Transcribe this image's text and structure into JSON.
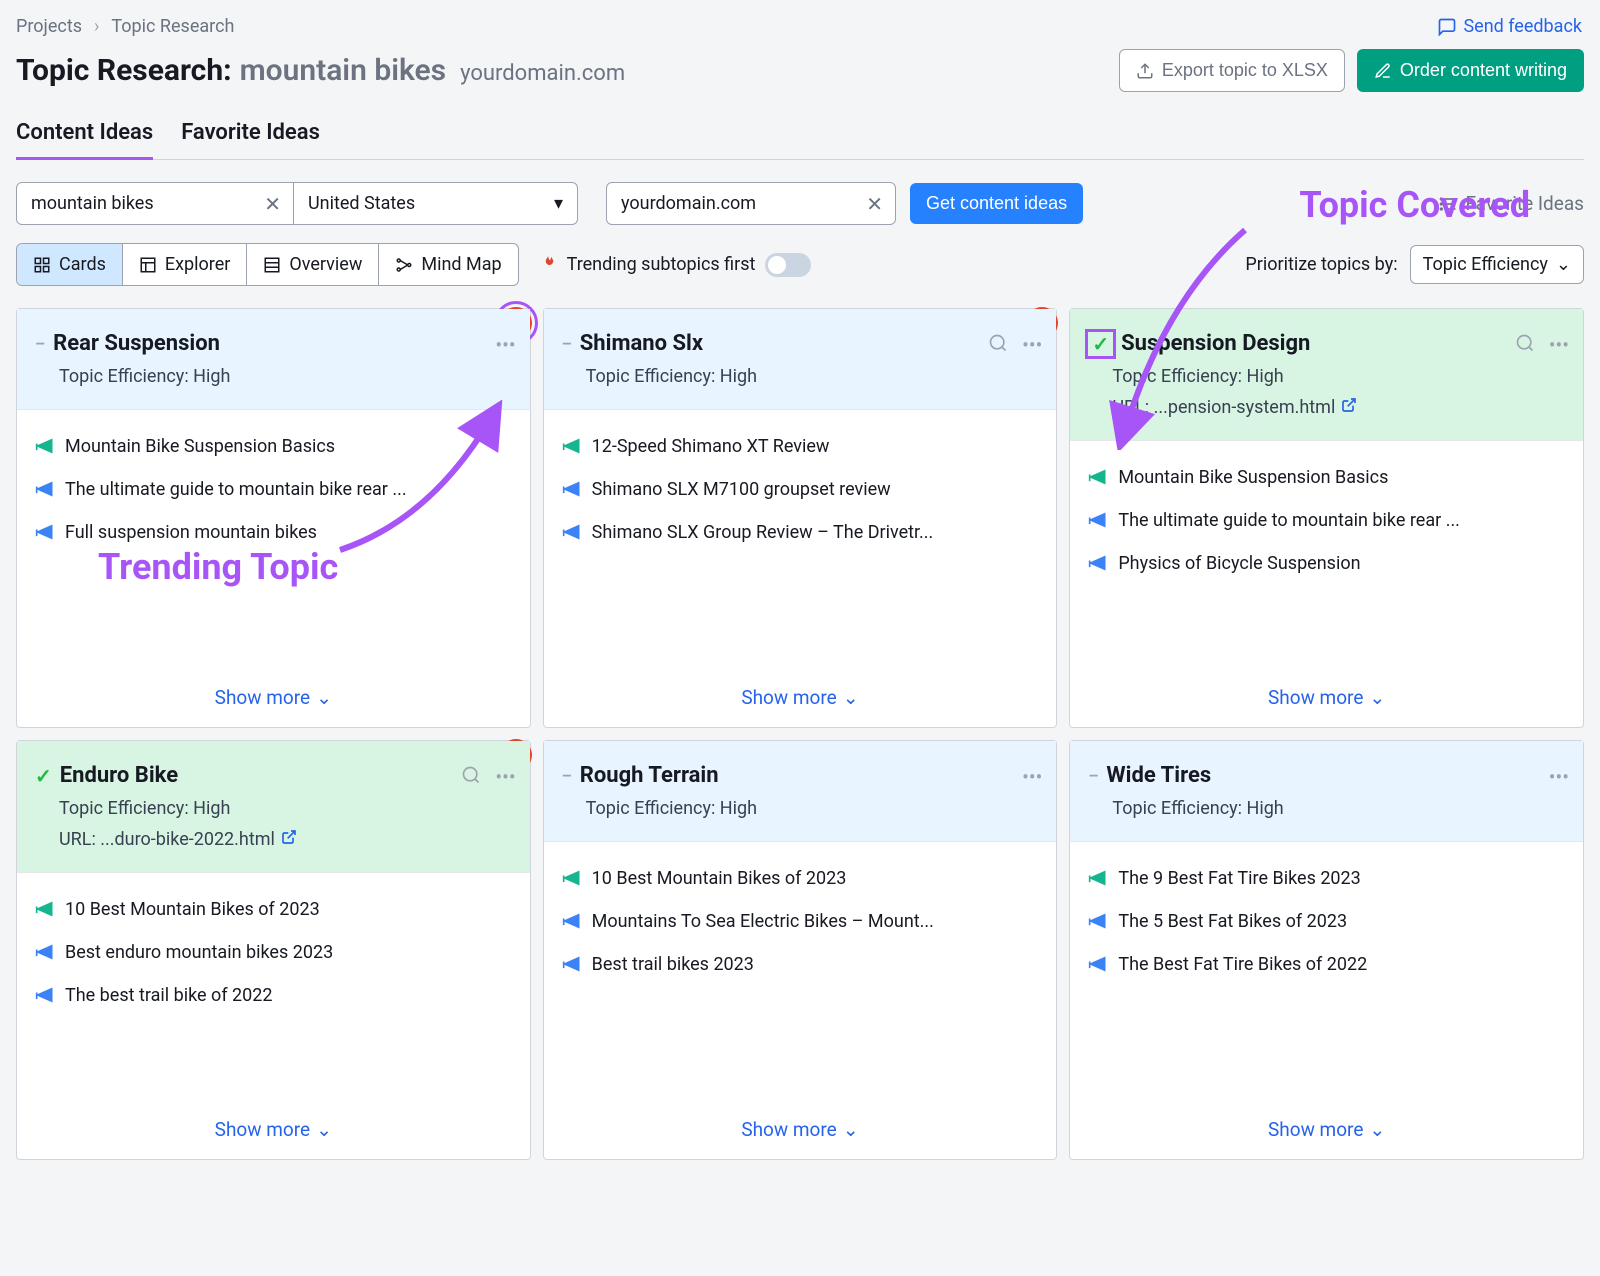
{
  "breadcrumb": {
    "root": "Projects",
    "current": "Topic Research"
  },
  "feedback_label": "Send feedback",
  "page_title": {
    "prefix": "Topic Research:",
    "query": "mountain bikes",
    "domain": "yourdomain.com"
  },
  "actions": {
    "export": "Export topic to XLSX",
    "order": "Order content writing"
  },
  "tabs": {
    "content": "Content Ideas",
    "favorite": "Favorite Ideas"
  },
  "filters": {
    "topic_value": "mountain bikes",
    "country_value": "United States",
    "domain_value": "yourdomain.com",
    "submit": "Get content ideas",
    "favorite_link": "Favorite Ideas"
  },
  "views": {
    "cards": "Cards",
    "explorer": "Explorer",
    "overview": "Overview",
    "mindmap": "Mind Map"
  },
  "trending_toggle_label": "Trending subtopics first",
  "prioritize": {
    "label": "Prioritize topics by:",
    "value": "Topic Efficiency"
  },
  "annotations": {
    "trending": "Trending Topic",
    "covered": "Topic Covered"
  },
  "show_more": "Show more",
  "cards": [
    {
      "title": "Rear Suspension",
      "efficiency": "Topic Efficiency:  High",
      "trending": true,
      "trending_boxed": true,
      "covered": false,
      "headlines": [
        {
          "text": "Mountain Bike Suspension Basics",
          "tone": "green"
        },
        {
          "text": "The ultimate guide to mountain bike rear ...",
          "tone": "blue"
        },
        {
          "text": "Full suspension mountain bikes",
          "tone": "blue"
        }
      ]
    },
    {
      "title": "Shimano Slx",
      "efficiency": "Topic Efficiency:  High",
      "trending": true,
      "covered": false,
      "show_search": true,
      "headlines": [
        {
          "text": "12-Speed Shimano XT Review",
          "tone": "green"
        },
        {
          "text": "Shimano SLX M7100 groupset review",
          "tone": "blue"
        },
        {
          "text": "Shimano SLX Group Review – The Drivetr...",
          "tone": "blue"
        }
      ]
    },
    {
      "title": "Suspension Design",
      "efficiency": "Topic Efficiency:  High",
      "trending": false,
      "covered": true,
      "covered_boxed": true,
      "show_search": true,
      "url": "URL:  ...pension-system.html",
      "headlines": [
        {
          "text": "Mountain Bike Suspension Basics",
          "tone": "green"
        },
        {
          "text": "The ultimate guide to mountain bike rear ...",
          "tone": "blue"
        },
        {
          "text": "Physics of Bicycle Suspension",
          "tone": "blue"
        }
      ]
    },
    {
      "title": "Enduro Bike",
      "efficiency": "Topic Efficiency:  High",
      "trending": true,
      "covered": true,
      "show_search": true,
      "url": "URL:  ...duro-bike-2022.html",
      "headlines": [
        {
          "text": "10 Best Mountain Bikes of 2023",
          "tone": "green"
        },
        {
          "text": "Best enduro mountain bikes 2023",
          "tone": "blue"
        },
        {
          "text": "The best trail bike of 2022",
          "tone": "blue"
        }
      ]
    },
    {
      "title": "Rough Terrain",
      "efficiency": "Topic Efficiency:  High",
      "trending": false,
      "covered": false,
      "headlines": [
        {
          "text": "10 Best Mountain Bikes of 2023",
          "tone": "green"
        },
        {
          "text": "Mountains To Sea Electric Bikes – Mount...",
          "tone": "blue"
        },
        {
          "text": "Best trail bikes 2023",
          "tone": "blue"
        }
      ]
    },
    {
      "title": "Wide Tires",
      "efficiency": "Topic Efficiency:  High",
      "trending": false,
      "covered": false,
      "headlines": [
        {
          "text": "The 9 Best Fat Tire Bikes 2023",
          "tone": "green"
        },
        {
          "text": "The 5 Best Fat Bikes of 2023",
          "tone": "blue"
        },
        {
          "text": "The Best Fat Tire Bikes of 2022",
          "tone": "blue"
        }
      ]
    }
  ]
}
